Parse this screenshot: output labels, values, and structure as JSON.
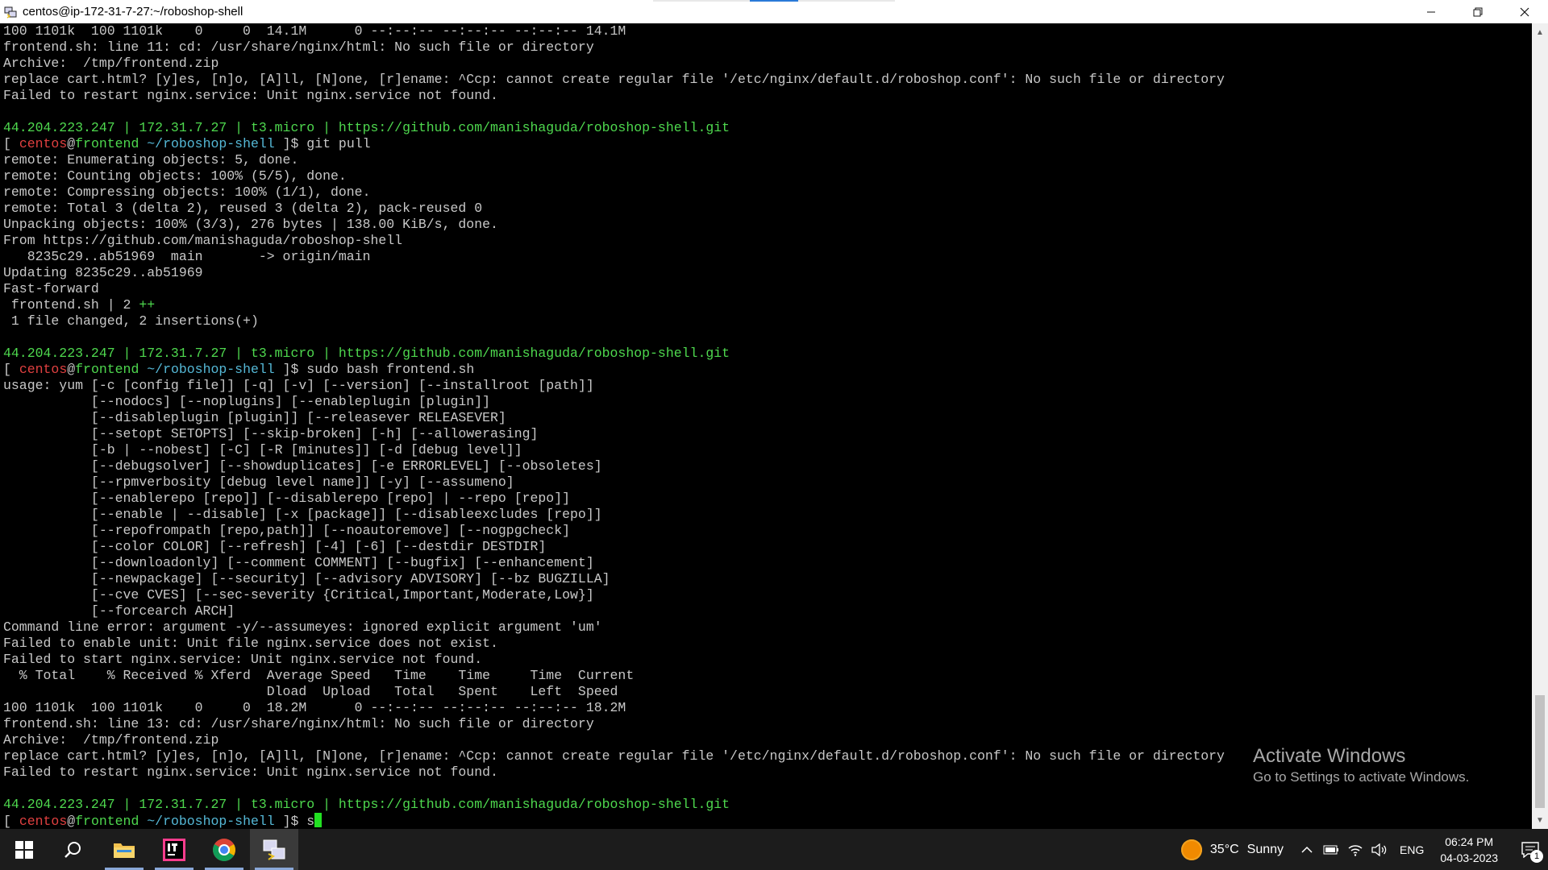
{
  "window": {
    "title": "centos@ip-172-31-7-27:~/roboshop-shell"
  },
  "terminal": {
    "lines": [
      [
        {
          "t": "100 1101k  100 1101k    0     0  14.1M      0 --:--:-- --:--:-- --:--:-- 14.1M"
        }
      ],
      [
        {
          "t": "frontend.sh: line 11: cd: /usr/share/nginx/html: No such file or directory"
        }
      ],
      [
        {
          "t": "Archive:  /tmp/frontend.zip"
        }
      ],
      [
        {
          "t": "replace cart.html? [y]es, [n]o, [A]ll, [N]one, [r]ename: ^Ccp: cannot create regular file '/etc/nginx/default.d/roboshop.conf': No such file or directory"
        }
      ],
      [
        {
          "t": "Failed to restart nginx.service: Unit nginx.service not found."
        }
      ],
      [
        {
          "t": ""
        }
      ],
      [
        {
          "t": "44.204.223.247 | 172.31.7.27 | t3.micro | https://github.com/manishaguda/roboshop-shell.git",
          "c": "green"
        }
      ],
      [
        {
          "t": "[ "
        },
        {
          "t": "centos",
          "c": "red"
        },
        {
          "t": "@"
        },
        {
          "t": "frontend",
          "c": "green"
        },
        {
          "t": " "
        },
        {
          "t": "~/roboshop-shell",
          "c": "cyan"
        },
        {
          "t": " ]$ git pull"
        }
      ],
      [
        {
          "t": "remote: Enumerating objects: 5, done."
        }
      ],
      [
        {
          "t": "remote: Counting objects: 100% (5/5), done."
        }
      ],
      [
        {
          "t": "remote: Compressing objects: 100% (1/1), done."
        }
      ],
      [
        {
          "t": "remote: Total 3 (delta 2), reused 3 (delta 2), pack-reused 0"
        }
      ],
      [
        {
          "t": "Unpacking objects: 100% (3/3), 276 bytes | 138.00 KiB/s, done."
        }
      ],
      [
        {
          "t": "From https://github.com/manishaguda/roboshop-shell"
        }
      ],
      [
        {
          "t": "   8235c29..ab51969  main       -> origin/main"
        }
      ],
      [
        {
          "t": "Updating 8235c29..ab51969"
        }
      ],
      [
        {
          "t": "Fast-forward"
        }
      ],
      [
        {
          "t": " frontend.sh | 2 "
        },
        {
          "t": "++",
          "c": "green"
        }
      ],
      [
        {
          "t": " 1 file changed, 2 insertions(+)"
        }
      ],
      [
        {
          "t": ""
        }
      ],
      [
        {
          "t": "44.204.223.247 | 172.31.7.27 | t3.micro | https://github.com/manishaguda/roboshop-shell.git",
          "c": "green"
        }
      ],
      [
        {
          "t": "[ "
        },
        {
          "t": "centos",
          "c": "red"
        },
        {
          "t": "@"
        },
        {
          "t": "frontend",
          "c": "green"
        },
        {
          "t": " "
        },
        {
          "t": "~/roboshop-shell",
          "c": "cyan"
        },
        {
          "t": " ]$ sudo bash frontend.sh"
        }
      ],
      [
        {
          "t": "usage: yum [-c [config file]] [-q] [-v] [--version] [--installroot [path]]"
        }
      ],
      [
        {
          "t": "           [--nodocs] [--noplugins] [--enableplugin [plugin]]"
        }
      ],
      [
        {
          "t": "           [--disableplugin [plugin]] [--releasever RELEASEVER]"
        }
      ],
      [
        {
          "t": "           [--setopt SETOPTS] [--skip-broken] [-h] [--allowerasing]"
        }
      ],
      [
        {
          "t": "           [-b | --nobest] [-C] [-R [minutes]] [-d [debug level]]"
        }
      ],
      [
        {
          "t": "           [--debugsolver] [--showduplicates] [-e ERRORLEVEL] [--obsoletes]"
        }
      ],
      [
        {
          "t": "           [--rpmverbosity [debug level name]] [-y] [--assumeno]"
        }
      ],
      [
        {
          "t": "           [--enablerepo [repo]] [--disablerepo [repo] | --repo [repo]]"
        }
      ],
      [
        {
          "t": "           [--enable | --disable] [-x [package]] [--disableexcludes [repo]]"
        }
      ],
      [
        {
          "t": "           [--repofrompath [repo,path]] [--noautoremove] [--nogpgcheck]"
        }
      ],
      [
        {
          "t": "           [--color COLOR] [--refresh] [-4] [-6] [--destdir DESTDIR]"
        }
      ],
      [
        {
          "t": "           [--downloadonly] [--comment COMMENT] [--bugfix] [--enhancement]"
        }
      ],
      [
        {
          "t": "           [--newpackage] [--security] [--advisory ADVISORY] [--bz BUGZILLA]"
        }
      ],
      [
        {
          "t": "           [--cve CVES] [--sec-severity {Critical,Important,Moderate,Low}]"
        }
      ],
      [
        {
          "t": "           [--forcearch ARCH]"
        }
      ],
      [
        {
          "t": "Command line error: argument -y/--assumeyes: ignored explicit argument 'um'"
        }
      ],
      [
        {
          "t": "Failed to enable unit: Unit file nginx.service does not exist."
        }
      ],
      [
        {
          "t": "Failed to start nginx.service: Unit nginx.service not found."
        }
      ],
      [
        {
          "t": "  % Total    % Received % Xferd  Average Speed   Time    Time     Time  Current"
        }
      ],
      [
        {
          "t": "                                 Dload  Upload   Total   Spent    Left  Speed"
        }
      ],
      [
        {
          "t": "100 1101k  100 1101k    0     0  18.2M      0 --:--:-- --:--:-- --:--:-- 18.2M"
        }
      ],
      [
        {
          "t": "frontend.sh: line 13: cd: /usr/share/nginx/html: No such file or directory"
        }
      ],
      [
        {
          "t": "Archive:  /tmp/frontend.zip"
        }
      ],
      [
        {
          "t": "replace cart.html? [y]es, [n]o, [A]ll, [N]one, [r]ename: ^Ccp: cannot create regular file '/etc/nginx/default.d/roboshop.conf': No such file or directory"
        }
      ],
      [
        {
          "t": "Failed to restart nginx.service: Unit nginx.service not found."
        }
      ],
      [
        {
          "t": ""
        }
      ],
      [
        {
          "t": "44.204.223.247 | 172.31.7.27 | t3.micro | https://github.com/manishaguda/roboshop-shell.git",
          "c": "green"
        }
      ],
      [
        {
          "t": "[ "
        },
        {
          "t": "centos",
          "c": "red"
        },
        {
          "t": "@"
        },
        {
          "t": "frontend",
          "c": "green"
        },
        {
          "t": " "
        },
        {
          "t": "~/roboshop-shell",
          "c": "cyan"
        },
        {
          "t": " ]$ s"
        }
      ]
    ]
  },
  "watermark": {
    "title": "Activate Windows",
    "subtitle": "Go to Settings to activate Windows."
  },
  "taskbar": {
    "apps": [
      {
        "name": "start-button",
        "icon": "windows-logo-icon"
      },
      {
        "name": "search-button",
        "icon": "search-icon"
      },
      {
        "name": "file-explorer-button",
        "icon": "folder-icon"
      },
      {
        "name": "intellij-button",
        "icon": "intellij-icon"
      },
      {
        "name": "chrome-button",
        "icon": "chrome-icon"
      },
      {
        "name": "putty-button",
        "icon": "putty-icon",
        "active": true
      }
    ],
    "weather": {
      "temp": "35°C",
      "condition": "Sunny"
    },
    "language": "ENG",
    "clock": {
      "time": "06:24 PM",
      "date": "04-03-2023"
    },
    "notifications_count": "1"
  },
  "colors": {
    "prompt_green": "#4ed84e",
    "prompt_red": "#e04040",
    "prompt_cyan": "#55b8d6",
    "text": "#c8c8c8",
    "cursor": "#22e022"
  }
}
